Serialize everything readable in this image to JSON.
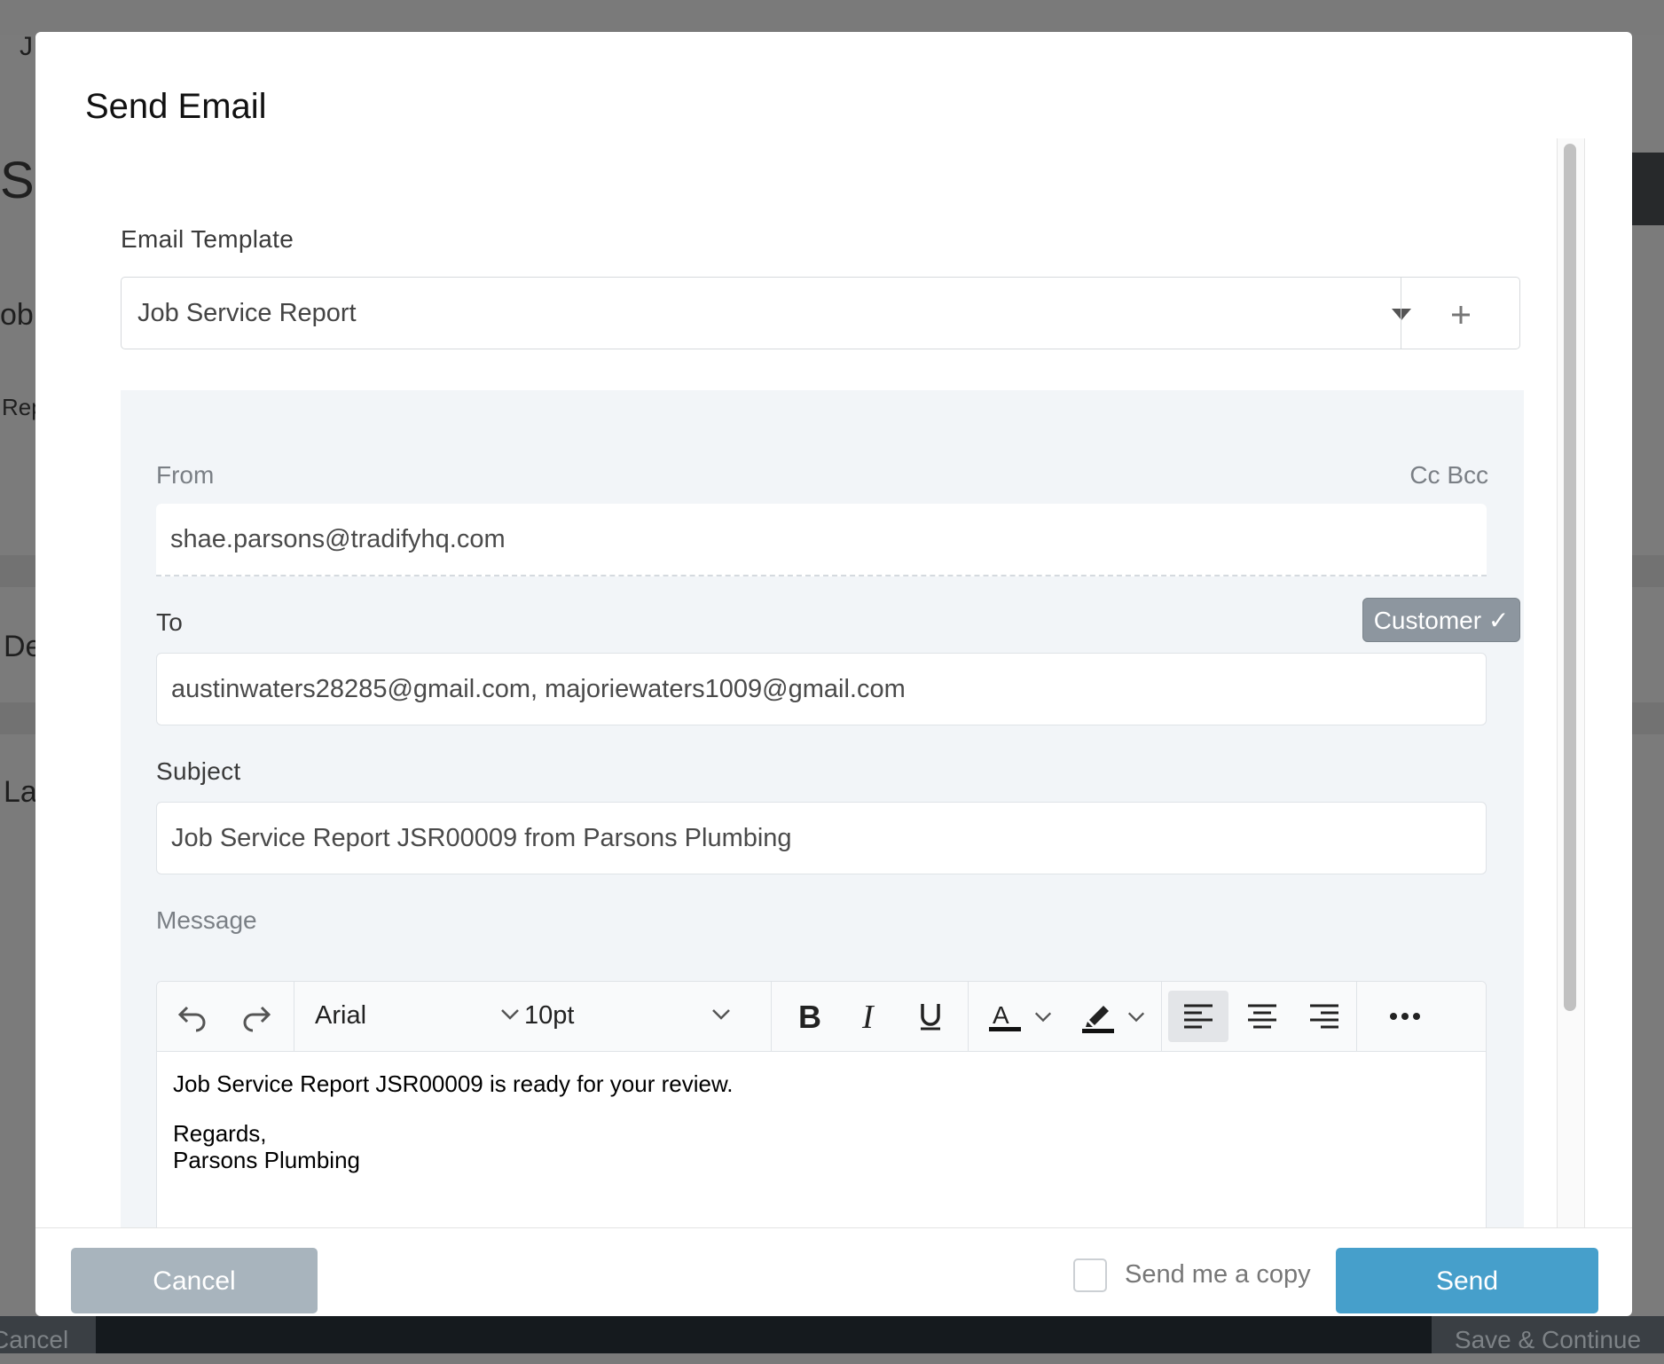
{
  "background": {
    "fragments": [
      "J",
      "SR",
      "ob",
      "Rep",
      "De",
      "La"
    ],
    "bottom_left_button": "Cancel",
    "bottom_right_button": "Save & Continue"
  },
  "modal": {
    "title": "Send Email",
    "template": {
      "label": "Email Template",
      "selected": "Job Service Report",
      "add_icon": "plus-icon"
    },
    "from": {
      "label": "From",
      "value": "shae.parsons@tradifyhq.com",
      "cc_bcc": "Cc Bcc"
    },
    "to": {
      "label": "To",
      "value": "austinwaters28285@gmail.com, majoriewaters1009@gmail.com",
      "badge": "Customer ✓"
    },
    "subject": {
      "label": "Subject",
      "value": "Job Service Report JSR00009 from Parsons Plumbing"
    },
    "message": {
      "label": "Message",
      "toolbar": {
        "font": "Arial",
        "size": "10pt"
      },
      "body": [
        "Job Service Report JSR00009 is ready for your review.",
        "",
        "Regards,",
        "Parsons Plumbing"
      ]
    },
    "footer": {
      "cancel": "Cancel",
      "send_copy": "Send me a copy",
      "send": "Send"
    }
  },
  "colors": {
    "send_button": "#469fcb",
    "cancel_button": "#a8b4bd",
    "customer_badge": "#8d969f"
  }
}
